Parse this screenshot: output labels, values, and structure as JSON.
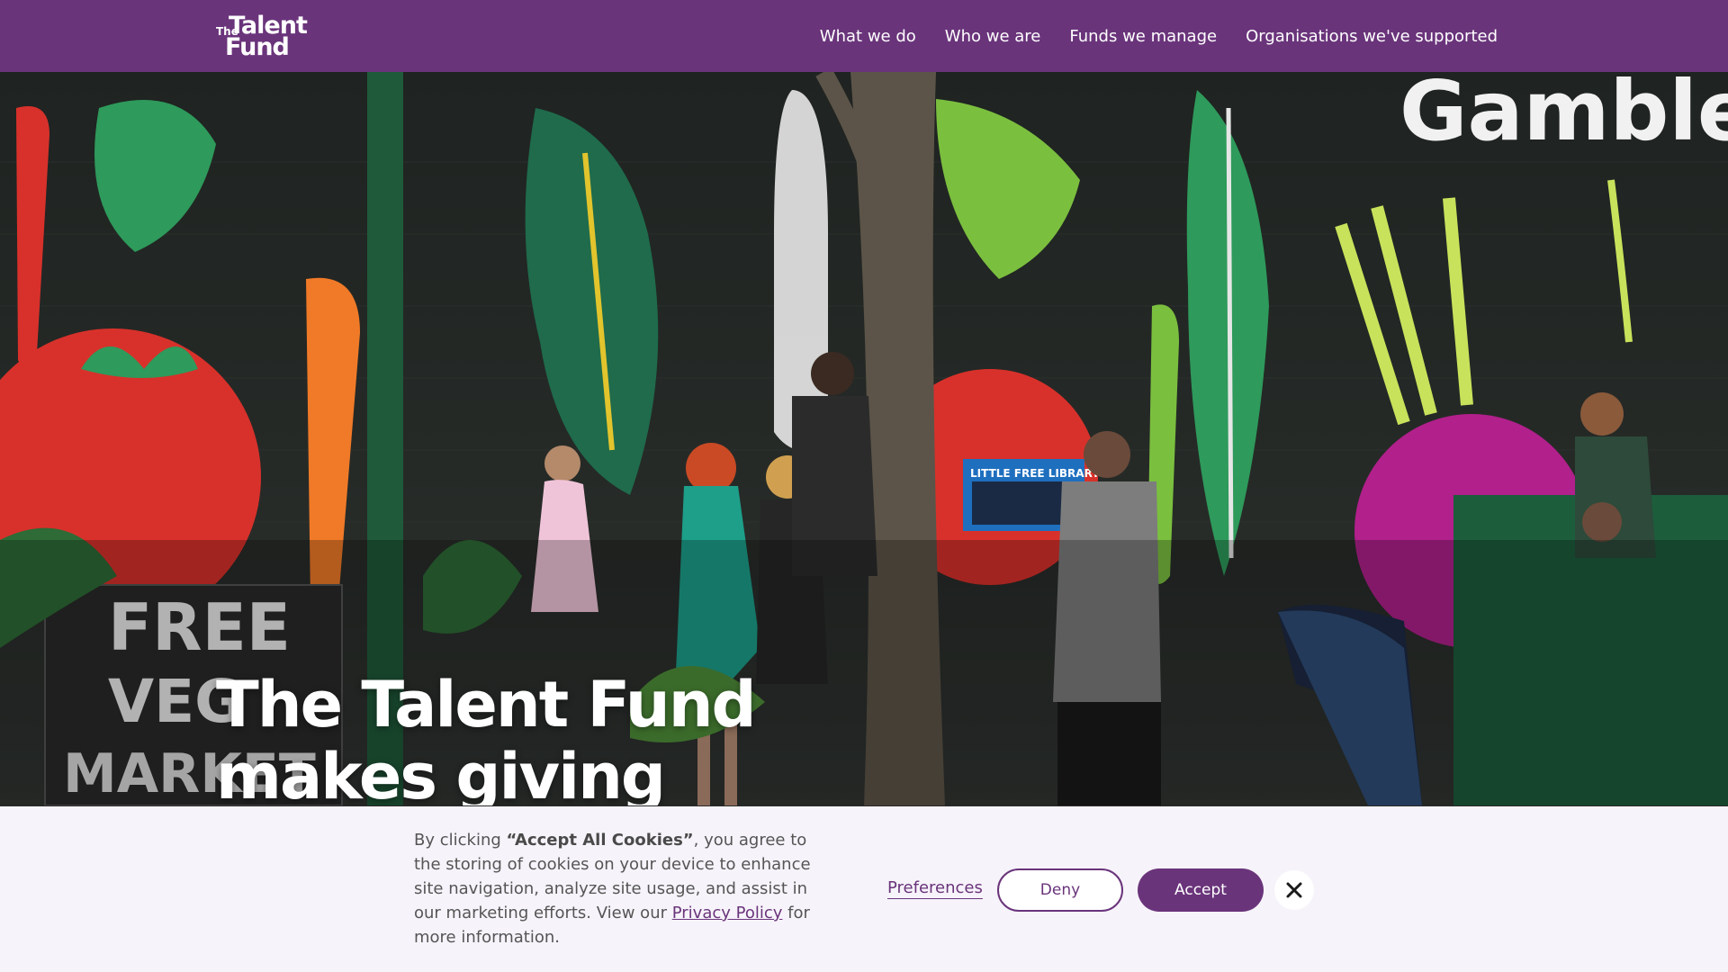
{
  "header": {
    "logo": {
      "the": "The",
      "talent": "Talent",
      "fund": "Fund"
    },
    "nav": [
      "What we do",
      "Who we are",
      "Funds we manage",
      "Organisations we've supported"
    ]
  },
  "hero": {
    "title_line1": "The Talent Fund",
    "title_line2": "makes giving",
    "mural_text": {
      "gamble": "Gamble",
      "free": "FREE",
      "veg": "VEG",
      "market": "MARKET",
      "library": "LITTLE FREE LIBRARY"
    }
  },
  "cookie": {
    "text_before": "By clicking ",
    "text_bold": "“Accept All Cookies”",
    "text_middle": ", you agree to the storing of cookies on your device to enhance site navigation, analyze site usage, and assist in our marketing efforts. View our ",
    "privacy_link": "Privacy Policy",
    "text_after": " for more information.",
    "preferences": "Preferences",
    "deny": "Deny",
    "accept": "Accept"
  },
  "colors": {
    "brand_purple": "#6a347b",
    "banner_bg": "#f6f3fa"
  }
}
